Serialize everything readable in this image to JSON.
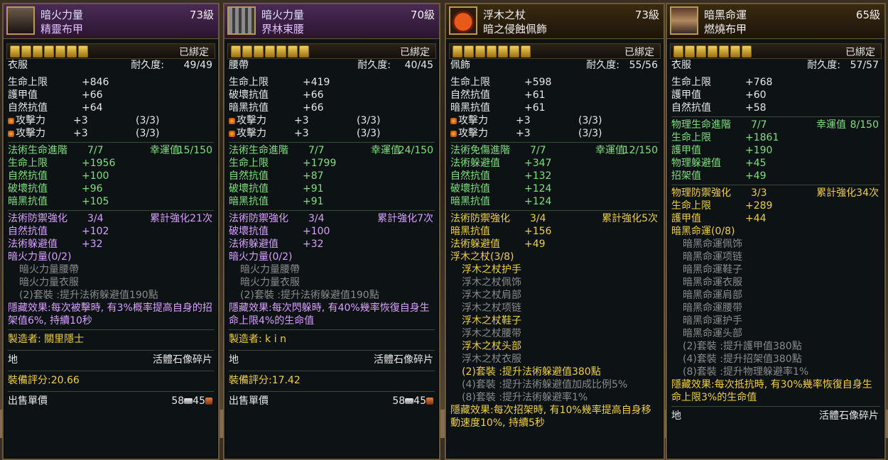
{
  "cards": [
    {
      "set": "暗火力量",
      "level": "73級",
      "item": "精靈布甲",
      "bound": "已綁定",
      "slot": "衣服",
      "durability_label": "耐久度:",
      "durability": "49/49",
      "base": [
        [
          "生命上限",
          "+846"
        ],
        [
          "護甲值",
          "+66"
        ],
        [
          "自然抗值",
          "+64"
        ]
      ],
      "gems": [
        [
          "攻擊力",
          "+3",
          "(3/3)"
        ],
        [
          "攻擊力",
          "+3",
          "(3/3)"
        ]
      ],
      "rank_title": "法術生命進階",
      "rank_val": "7/7",
      "luck_label": "幸運值",
      "luck": "15/150",
      "rank_stats": [
        [
          "生命上限",
          "+1956"
        ],
        [
          "自然抗值",
          "+100"
        ],
        [
          "破壞抗值",
          "+96"
        ],
        [
          "暗黑抗值",
          "+105"
        ]
      ],
      "enh_title": "法術防禦強化",
      "enh_val": "3/4",
      "enh_right": "累計強化21次",
      "enh_stats": [
        [
          "自然抗值",
          "+102"
        ],
        [
          "法術躲避值",
          "+32"
        ]
      ],
      "setname": "暗火力量(0/2)",
      "set_items": [
        "暗火力量腰帶",
        "暗火力量衣服"
      ],
      "set_bonus": [
        "(2)套裝  :提升法術躲避值190點"
      ],
      "hidden": "隱藏效果:每次被擊時, 有3%概率提高自身的招架值6%, 持續10秒",
      "maker": "製造者:  關里隱士",
      "place": "地",
      "place_right": "活體石像碎片",
      "score": "裝備評分:20.66",
      "sell": "出售單價",
      "silver": "58",
      "copper": "45"
    },
    {
      "set": "暗火力量",
      "level": "70級",
      "item": "界林束腰",
      "bound": "已綁定",
      "slot": "腰帶",
      "durability_label": "耐久度:",
      "durability": "40/45",
      "base": [
        [
          "生命上限",
          "+419"
        ],
        [
          "破壞抗值",
          "+66"
        ],
        [
          "暗黑抗值",
          "+66"
        ]
      ],
      "gems": [
        [
          "攻擊力",
          "+3",
          "(3/3)"
        ],
        [
          "攻擊力",
          "+3",
          "(3/3)"
        ]
      ],
      "rank_title": "法術生命進階",
      "rank_val": "7/7",
      "luck_label": "幸運值",
      "luck": "24/150",
      "rank_stats": [
        [
          "生命上限",
          "+1799"
        ],
        [
          "自然抗值",
          "+87"
        ],
        [
          "破壞抗值",
          "+91"
        ],
        [
          "暗黑抗值",
          "+91"
        ]
      ],
      "enh_title": "法術防禦強化",
      "enh_val": "3/4",
      "enh_right": "累計強化7次",
      "enh_stats": [
        [
          "破壞抗值",
          "+100"
        ],
        [
          "法術躲避值",
          "+32"
        ]
      ],
      "setname": "暗火力量(0/2)",
      "set_items": [
        "暗火力量腰帶",
        "暗火力量衣服"
      ],
      "set_bonus": [
        "(2)套裝  :提升法術躲避值190點"
      ],
      "hidden": "隱藏效果:每次閃躲時, 有40%幾率恢復自身生命上限4%的生命值",
      "maker": "製造者:  k i n",
      "place": "地",
      "place_right": "活體石像碎片",
      "score": "裝備評分:17.42",
      "sell": "出售單價",
      "silver": "58",
      "copper": "45"
    },
    {
      "set": "浮木之杖",
      "level": "73級",
      "item": "暗之侵蝕佩飾",
      "bound": "已綁定",
      "slot": "佩飾",
      "durability_label": "耐久度:",
      "durability": "55/56",
      "base": [
        [
          "生命上限",
          "+598"
        ],
        [
          "自然抗值",
          "+61"
        ],
        [
          "暗黑抗值",
          "+61"
        ]
      ],
      "gems": [
        [
          "攻擊力",
          "+3",
          "(3/3)"
        ],
        [
          "攻擊力",
          "+3",
          "(3/3)"
        ]
      ],
      "rank_title": "法術免傷進階",
      "rank_val": "7/7",
      "luck_label": "幸運值",
      "luck": "12/150",
      "rank_stats": [
        [
          "法術躲避值",
          "+347"
        ],
        [
          "自然抗值",
          "+132"
        ],
        [
          "破壞抗值",
          "+124"
        ],
        [
          "暗黑抗值",
          "+124"
        ]
      ],
      "enh_title": "法術防禦強化",
      "enh_val": "3/4",
      "enh_right": "累計強化5次",
      "enh_stats": [
        [
          "暗黑抗值",
          "+156"
        ],
        [
          "法術躲避值",
          "+49"
        ]
      ],
      "setname": "浮木之杖(3/8)",
      "set_items": [
        [
          "浮木之杖护手",
          1
        ],
        [
          "浮木之杖佩饰",
          0
        ],
        [
          "浮木之杖肩部",
          0
        ],
        [
          "浮木之杖项链",
          0
        ],
        [
          "浮木之杖鞋子",
          1
        ],
        [
          "浮木之杖腰带",
          0
        ],
        [
          "浮木之杖头部",
          1
        ],
        [
          "浮木之杖衣服",
          0
        ]
      ],
      "set_bonus": [
        [
          "(2)套裝  :提升法術躲避值380點",
          1
        ],
        [
          "(4)套裝  :提升法術躲避值加成比例5%",
          0
        ],
        [
          "(8)套裝  :提升法術躲避率1%",
          0
        ]
      ],
      "hidden": "隱藏效果:每次招架時, 有10%幾率提高自身移動速度10%, 持續5秒"
    },
    {
      "set": "暗黑命運",
      "level": "65級",
      "item": "燃燒布甲",
      "bound": "已綁定",
      "slot": "衣服",
      "durability_label": "耐久度:",
      "durability": "57/57",
      "base": [
        [
          "生命上限",
          "+768"
        ],
        [
          "護甲值",
          "+60"
        ],
        [
          "自然抗值",
          "+58"
        ]
      ],
      "rank_title": "物理生命進階",
      "rank_val": "7/7",
      "luck_label": "幸運值",
      "luck": "8/150",
      "rank_stats": [
        [
          "生命上限",
          "+1861"
        ],
        [
          "護甲值",
          "+190"
        ],
        [
          "物理躲避值",
          "+45"
        ],
        [
          "招架值",
          "+49"
        ]
      ],
      "enh_title": "物理防禦強化",
      "enh_val": "3/3",
      "enh_right": "累計強化34次",
      "enh_stats": [
        [
          "生命上限",
          "+289"
        ],
        [
          "護甲值",
          "+44"
        ]
      ],
      "setname": "暗黑命運(0/8)",
      "set_items": [
        "暗黑命運佩饰",
        "暗黑命運项链",
        "暗黑命運鞋子",
        "暗黑命運衣服",
        "暗黑命運肩部",
        "暗黑命運腰带",
        "暗黑命運护手",
        "暗黑命運头部"
      ],
      "set_bonus": [
        "(2)套裝  :提升護甲值380點",
        "(4)套裝  :提升招架值380點",
        "(8)套裝  :提升物理躲避率1%"
      ],
      "hidden": "隱藏效果:每次抵抗時, 有30%幾率恢復自身生命上限3%的生命值",
      "place": "地",
      "place_right": "活體石像碎片"
    }
  ]
}
